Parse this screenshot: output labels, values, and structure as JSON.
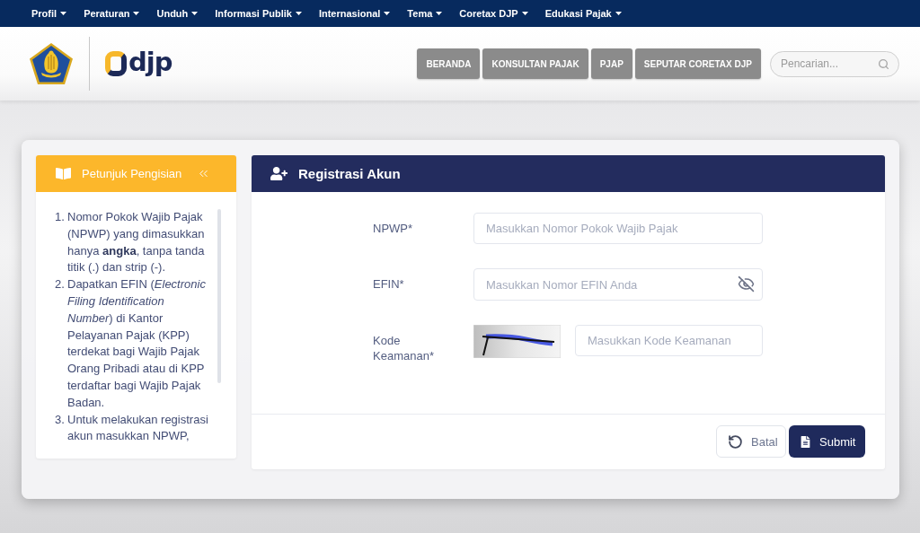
{
  "top_nav": {
    "items": [
      {
        "label": "Profil"
      },
      {
        "label": "Peraturan"
      },
      {
        "label": "Unduh"
      },
      {
        "label": "Informasi Publik"
      },
      {
        "label": "Internasional"
      },
      {
        "label": "Tema"
      },
      {
        "label": "Coretax DJP"
      },
      {
        "label": "Edukasi Pajak"
      }
    ]
  },
  "header": {
    "logo": {
      "text": "djp"
    },
    "nav_buttons": [
      {
        "label": "BERANDA"
      },
      {
        "label": "KONSULTAN PAJAK"
      },
      {
        "label": "PJAP"
      },
      {
        "label": "SEPUTAR CORETAX DJP"
      }
    ],
    "search": {
      "placeholder": "Pencarian..."
    }
  },
  "guide_panel": {
    "title": "Petunjuk Pengisian",
    "items": [
      {
        "number": "1.",
        "text": "Nomor Pokok Wajib Pajak (NPWP) yang dimasukkan hanya **angka**, tanpa tanda titik (.) dan strip (-)."
      },
      {
        "number": "2.",
        "text": "Dapatkan EFIN (*Electronic Filing Identification Number*) di Kantor Pelayanan Pajak (KPP) terdekat bagi Wajib Pajak Orang Pribadi atau di KPP terdaftar bagi Wajib Pajak Badan."
      },
      {
        "number": "3.",
        "text": "Untuk melakukan registrasi akun masukkan NPWP,"
      }
    ]
  },
  "form_panel": {
    "title": "Registrasi Akun",
    "fields": [
      {
        "kind": "text",
        "label": "NPWP*",
        "placeholder": "Masukkan Nomor Pokok Wajib Pajak"
      },
      {
        "kind": "password",
        "label": "EFIN*",
        "placeholder": "Masukkan Nomor EFIN Anda"
      },
      {
        "kind": "captcha",
        "label": "Kode Keamanan*",
        "placeholder": "Masukkan Kode Keamanan"
      }
    ],
    "buttons": [
      {
        "kind": "secondary",
        "label": "Batal"
      },
      {
        "kind": "primary",
        "label": "Submit"
      }
    ]
  }
}
